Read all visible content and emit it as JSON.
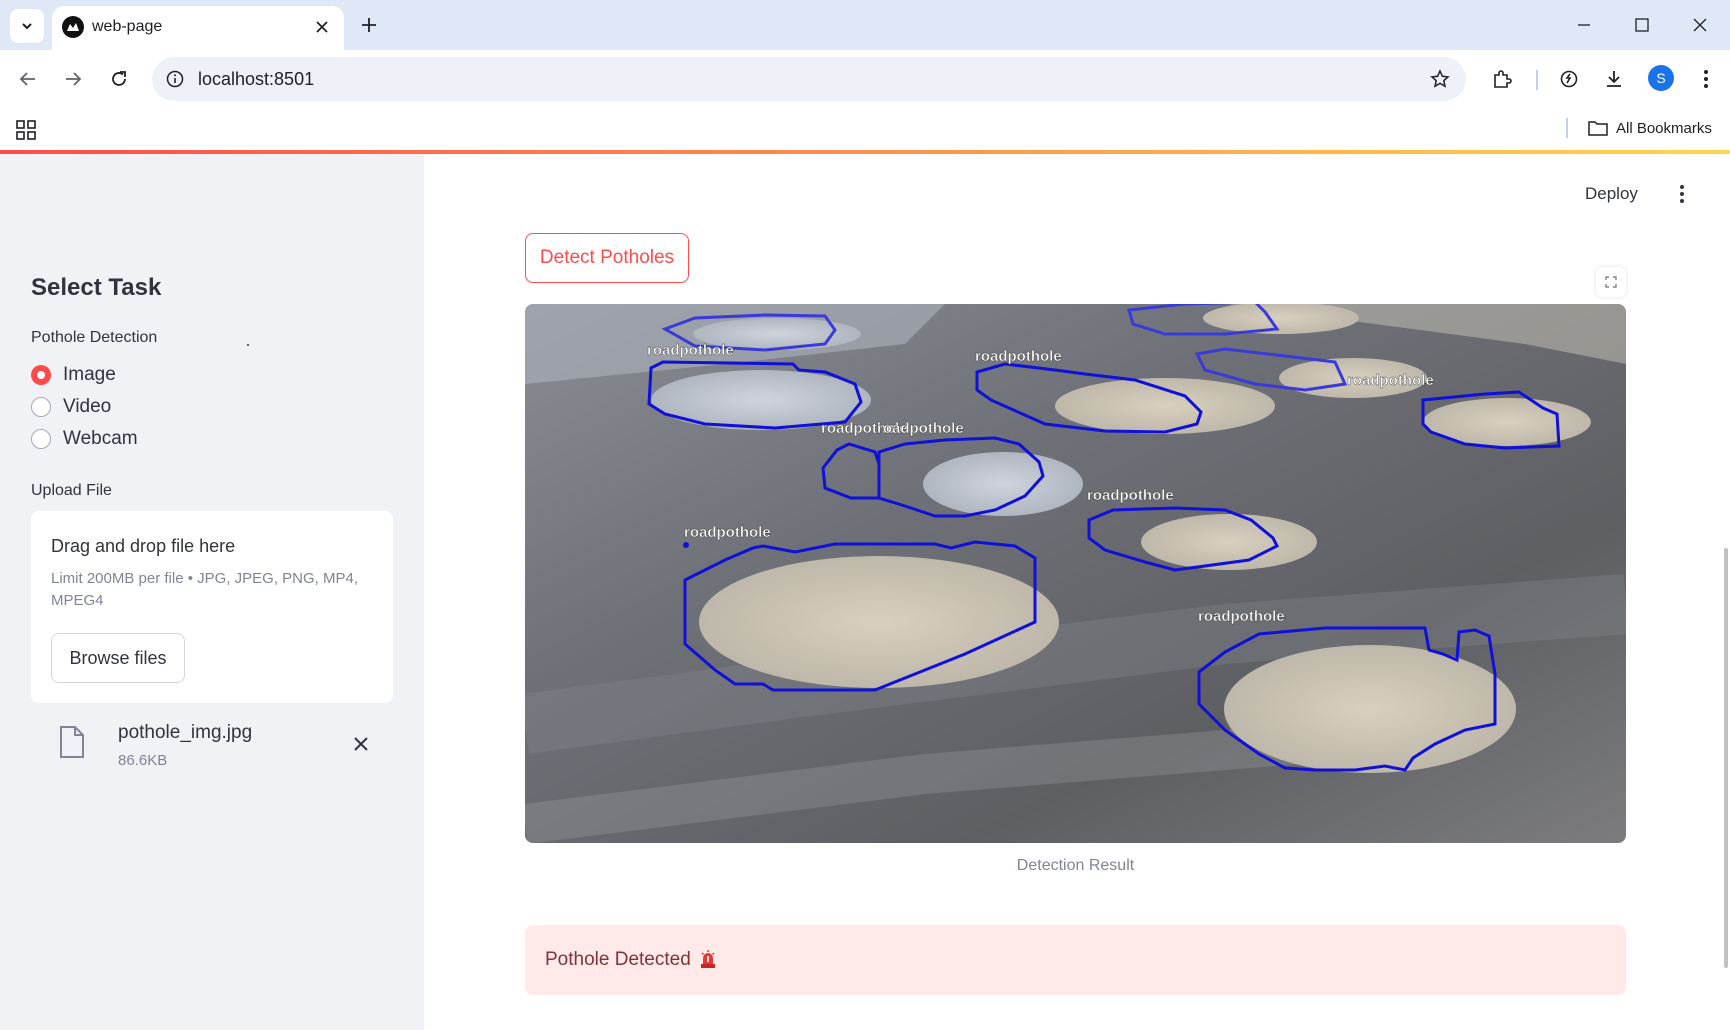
{
  "browser": {
    "tab_title": "web-page",
    "url": "localhost:8501",
    "profile_initial": "S",
    "bookmarks_label": "All Bookmarks"
  },
  "app": {
    "deploy_label": "Deploy",
    "sidebar": {
      "title": "Select Task",
      "task_label": "Pothole Detection",
      "options": [
        "Image",
        "Video",
        "Webcam"
      ],
      "selected_option": "Image",
      "upload_label": "Upload File",
      "dropzone_title": "Drag and drop file here",
      "dropzone_limit": "Limit 200MB per file • JPG, JPEG, PNG, MP4, MPEG4",
      "browse_label": "Browse files",
      "file": {
        "name": "pothole_img.jpg",
        "size": "86.6KB"
      }
    },
    "main": {
      "detect_label": "Detect Potholes",
      "detection_labels": [
        "roadpothole",
        "roadpothole",
        "roadpothole",
        "roadpothole",
        "roadpothole",
        "roadpothole",
        "roadpothole",
        "roadpothole"
      ],
      "caption": "Detection Result",
      "alert_text": "Pothole Detected",
      "alert_icon": "siren-icon"
    }
  },
  "colors": {
    "accent": "#ff4b4b",
    "sidebar_bg": "#f0f2f6",
    "alert_bg": "#ffe9e9",
    "detection_outline": "#1010d8"
  }
}
